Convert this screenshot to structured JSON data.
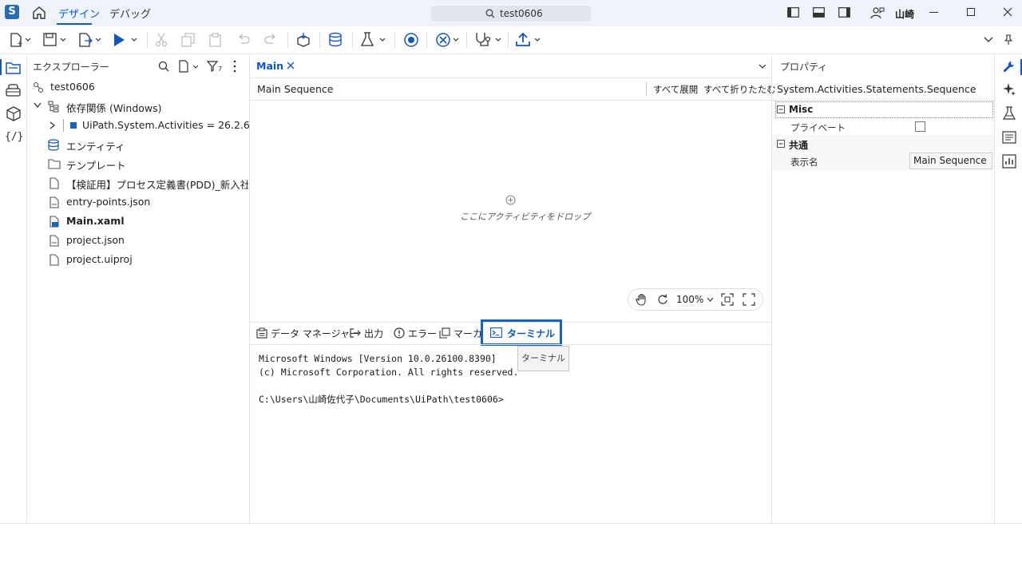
{
  "titlebar": {
    "tabs": {
      "design": "デザイン",
      "debug": "デバッグ"
    },
    "search_text": "test0606",
    "user_name": "山崎"
  },
  "explorer": {
    "title": "エクスプローラー",
    "project_name": "test0606",
    "dependencies": "依存関係 (Windows)",
    "dependency_item": "UiPath.System.Activities = 26.2.6",
    "entities": "エンティティ",
    "templates": "テンプレート",
    "pdd_file": "【検証用】プロセス定義書(PDD)_新入社員オン:",
    "entry_points": "entry-points.json",
    "main_xaml": "Main.xaml",
    "project_json": "project.json",
    "project_uiproj": "project.uiproj"
  },
  "designer": {
    "tab_label": "Main",
    "sequence_title": "Main Sequence",
    "expand_all": "すべて展開",
    "collapse_all": "すべて折りたたむ",
    "drop_hint": "ここにアクティビティをドロップ",
    "zoom": "100%"
  },
  "bottom_panel": {
    "tabs": {
      "data_manager": "データ マネージャー",
      "output": "出力",
      "errors": "エラー",
      "markers": "マーカー",
      "terminal": "ターミナル"
    },
    "tooltip": "ターミナル",
    "terminal_lines": [
      "Microsoft Windows [Version 10.0.26100.8390]",
      "(c) Microsoft Corporation. All rights reserved.",
      "",
      "C:\\Users\\山崎佐代子\\Documents\\UiPath\\test0606>"
    ]
  },
  "properties": {
    "title": "プロパティ",
    "type_name": "System.Activities.Statements.Sequence",
    "category_misc": "Misc",
    "private_label": "プライベート",
    "category_common": "共通",
    "display_name_label": "表示名",
    "display_name_value": "Main Sequence"
  },
  "colors": {
    "accent": "#1256c4",
    "highlight_frame": "#1565c0",
    "titlebar_bg": "#eef2f9"
  }
}
